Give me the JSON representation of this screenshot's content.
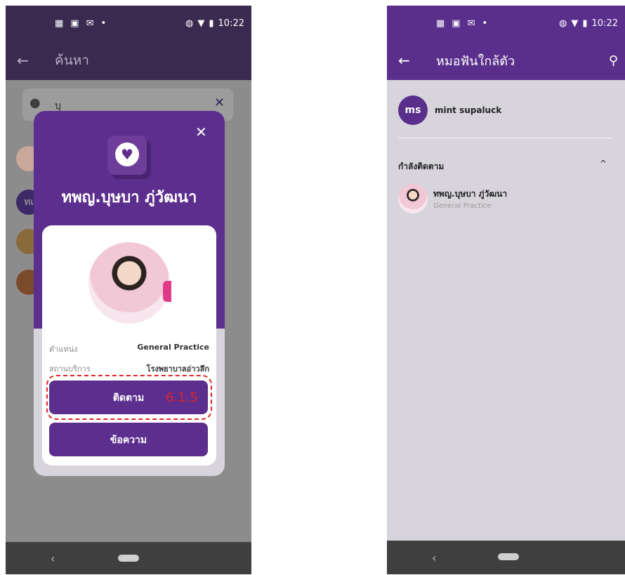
{
  "left": {
    "status": {
      "time": "10:22"
    },
    "appbar": {
      "back": "←",
      "title": "ค้นหา"
    },
    "search": {
      "query": "บุ",
      "clear": "✕"
    },
    "bg_avatar_initials": "ทเ",
    "modal": {
      "close": "✕",
      "doctor_name": "ทพญ.บุษบา ภู่วัฒนา",
      "position_label": "ตำแหน่ง",
      "position_value": "General Practice",
      "facility_label": "สถานบริการ",
      "facility_value": "โรงพยาบาลอ่าวลึก",
      "follow_button": "ติดตาม",
      "message_button": "ข้อความ"
    },
    "annotation": {
      "step": "6.1.5",
      "color": "#e02424"
    }
  },
  "right": {
    "status": {
      "time": "10:22"
    },
    "appbar": {
      "back": "←",
      "title": "หมอฟันใกล้ตัว"
    },
    "user": {
      "initials": "ms",
      "name": "mint supaluck"
    },
    "following": {
      "title": "กำลังติดตาม",
      "chevron": "^",
      "items": [
        {
          "name": "ทพญ.บุษบา ภู่วัฒนา",
          "specialty": "General Practice"
        }
      ]
    }
  },
  "colors": {
    "brand": "#5c2e8e",
    "appbar_left": "#3b2a50",
    "appbar_right": "#5a2f8c"
  },
  "icons": [
    "calendar-icon",
    "sheet-icon",
    "gmail-icon",
    "wifi-icon",
    "battery-icon",
    "search-icon",
    "tooth-icon"
  ]
}
